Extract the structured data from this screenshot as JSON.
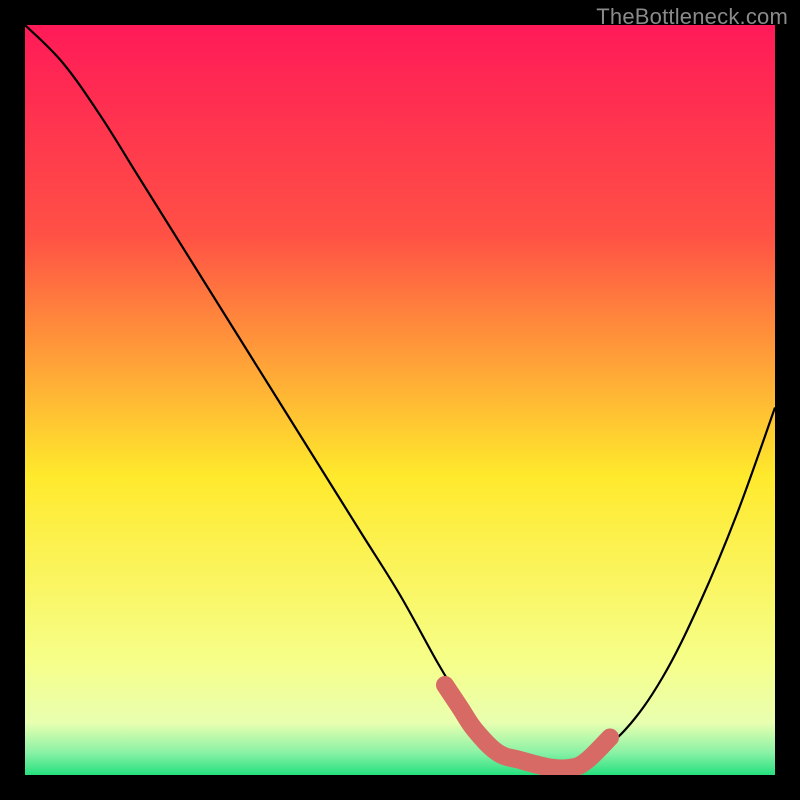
{
  "watermark": "TheBottleneck.com",
  "colors": {
    "frame": "#000000",
    "gradient_top": "#ff1a58",
    "gradient_mid_upper": "#ff7a3a",
    "gradient_mid": "#ffe92c",
    "gradient_lower": "#f6ff8a",
    "gradient_green": "#26e07f",
    "curve": "#000000",
    "highlight": "#d76a64"
  },
  "chart_data": {
    "type": "line",
    "title": "",
    "xlabel": "",
    "ylabel": "",
    "xlim": [
      0,
      100
    ],
    "ylim": [
      0,
      100
    ],
    "series": [
      {
        "name": "bottleneck-curve",
        "x": [
          0,
          5,
          10,
          15,
          20,
          25,
          30,
          35,
          40,
          45,
          50,
          55,
          58,
          60,
          63,
          66,
          70,
          73,
          75,
          80,
          85,
          90,
          95,
          100
        ],
        "values": [
          100,
          95,
          88,
          80,
          72,
          64,
          56,
          48,
          40,
          32,
          24,
          15,
          10,
          7,
          4,
          2,
          1,
          1,
          2,
          6,
          13,
          23,
          35,
          49
        ]
      }
    ],
    "highlight_region": {
      "name": "optimal-zone",
      "x": [
        56,
        58,
        60,
        63,
        66,
        70,
        73,
        75,
        78
      ],
      "values": [
        12,
        9,
        6,
        3,
        2,
        1,
        1,
        2,
        5
      ]
    }
  }
}
